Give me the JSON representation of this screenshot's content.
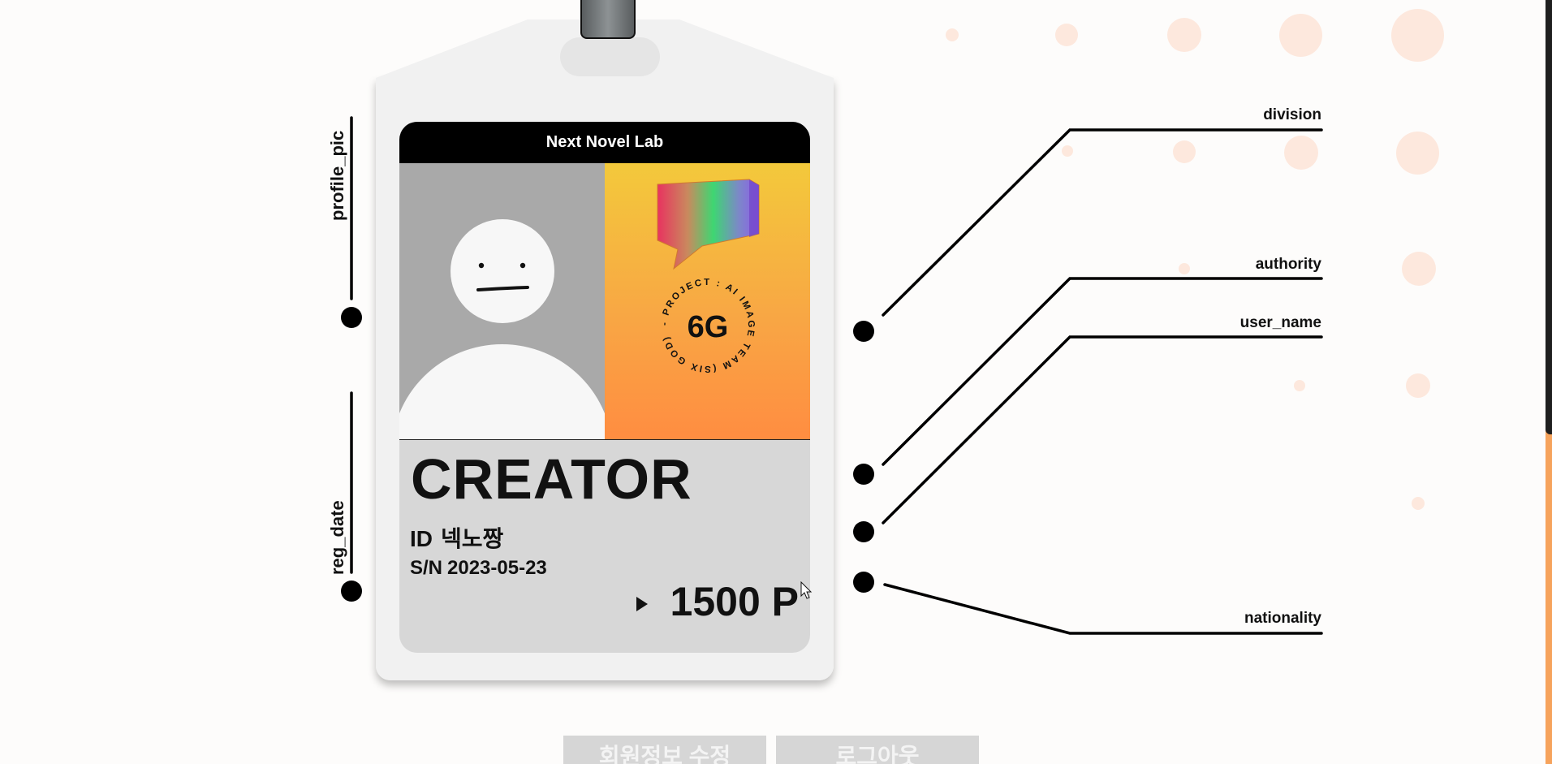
{
  "card": {
    "org_name": "Next Novel Lab",
    "role": "CREATOR",
    "id_label": "ID",
    "id_value": "넥노짱",
    "sn_label": "S/N",
    "sn_value": "2023-05-23",
    "points": "1500 P",
    "emblem_text": "6G",
    "emblem_ring_text": "- PROJECT : AI IMAGE TEAM (SIX GOD) "
  },
  "callouts": {
    "profile_pic": "profile_pic",
    "reg_date": "reg_date",
    "division": "division",
    "authority": "authority",
    "user_name": "user_name",
    "nationality": "nationality"
  },
  "buttons": {
    "edit_profile": "회원정보 수정",
    "logout": "로그아웃"
  },
  "colors": {
    "background": "#fdfcfb",
    "dots": "#fde8dd",
    "card_gradient_top": "#f3c93b",
    "card_gradient_bottom": "#ff8d41",
    "scrollbar_track": "#f6a35c"
  },
  "icons": [
    "lanyard-strap-icon",
    "avatar-placeholder-icon",
    "speech-bubble-logo-icon",
    "6g-emblem-icon",
    "play-arrow-icon",
    "mouse-cursor-icon"
  ]
}
